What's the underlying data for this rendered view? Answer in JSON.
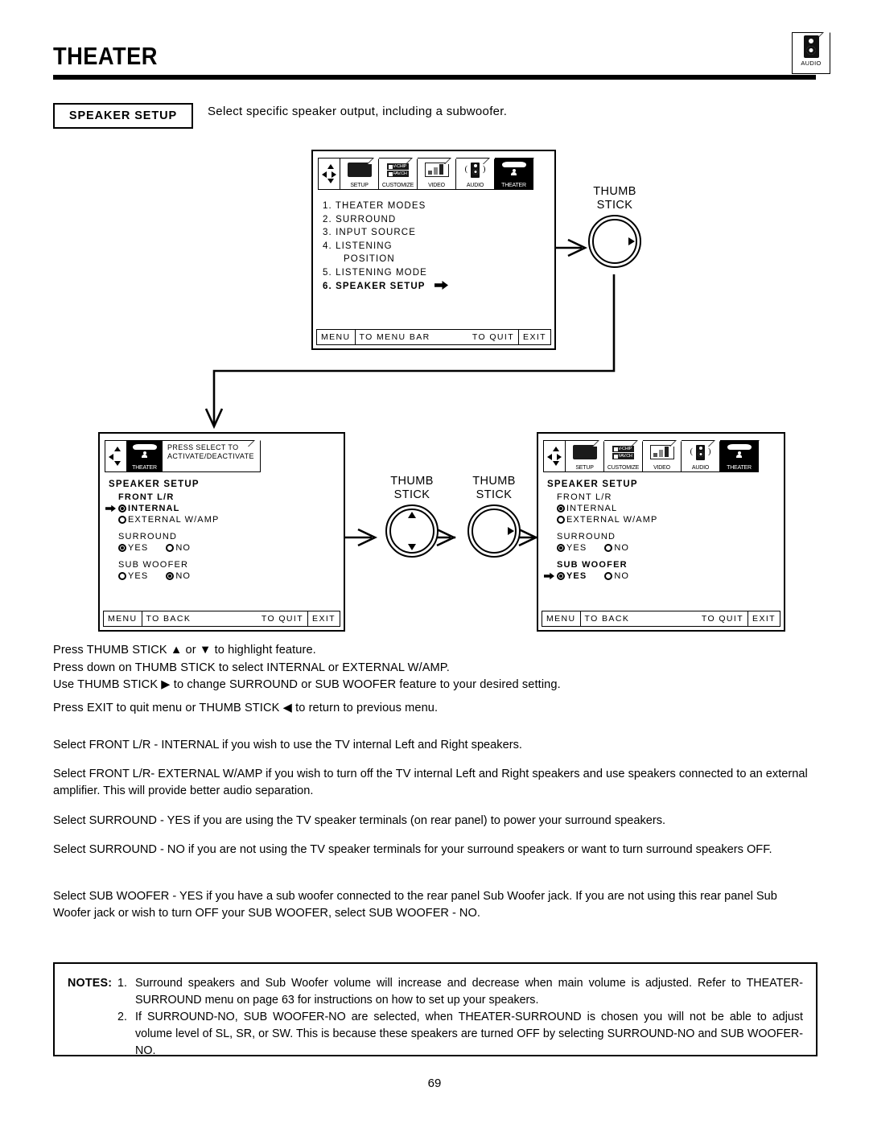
{
  "header": {
    "title": "THEATER",
    "badge": {
      "icon": "audio-speaker-icon",
      "label": "AUDIO"
    }
  },
  "section": {
    "tag": "SPEAKER SETUP",
    "description": "Select specific speaker output, including a subwoofer."
  },
  "osd_top": {
    "menubar": {
      "navpad": "navpad-icon",
      "tabs": [
        {
          "label": "SETUP",
          "icon": "tv-screen-icon",
          "selected": false
        },
        {
          "label": "CUSTOMIZE",
          "icon": "v-chip-icon",
          "selected": false,
          "lines": [
            "V-CHIP",
            "FAV.CH"
          ]
        },
        {
          "label": "VIDEO",
          "icon": "bar-levels-icon",
          "selected": false
        },
        {
          "label": "AUDIO",
          "icon": "speaker-icon",
          "selected": false
        },
        {
          "label": "THEATER",
          "icon": "theater-icon",
          "selected": true
        }
      ]
    },
    "items": [
      {
        "text": "1. THEATER MODES",
        "selected": false,
        "indent": false
      },
      {
        "text": "2. SURROUND",
        "selected": false,
        "indent": false
      },
      {
        "text": "3. INPUT SOURCE",
        "selected": false,
        "indent": false
      },
      {
        "text": "4. LISTENING",
        "selected": false,
        "indent": false
      },
      {
        "text": "POSITION",
        "selected": false,
        "indent": true
      },
      {
        "text": "5. LISTENING MODE",
        "selected": false,
        "indent": false
      },
      {
        "text": "6. SPEAKER SETUP",
        "selected": true,
        "indent": false,
        "arrow": true
      }
    ],
    "footer": {
      "menu": "MENU",
      "mid_left": "TO MENU BAR",
      "mid_right": "TO QUIT",
      "exit": "EXIT"
    }
  },
  "osd_left": {
    "tip": {
      "line1": "PRESS SELECT TO",
      "line2": "ACTIVATE/DEACTIVATE"
    },
    "tab": {
      "label": "THEATER",
      "icon": "theater-icon"
    },
    "title": "SPEAKER SETUP",
    "groups": [
      {
        "label": "FRONT L/R",
        "label_bold": true,
        "layout": "stacked",
        "options": [
          {
            "label": "INTERNAL",
            "selected": true,
            "cursor": true,
            "bold": true
          },
          {
            "label": "EXTERNAL W/AMP",
            "selected": false,
            "cursor": false,
            "bold": false
          }
        ]
      },
      {
        "label": "SURROUND",
        "label_bold": false,
        "layout": "row",
        "options": [
          {
            "label": "YES",
            "selected": true,
            "cursor": false,
            "bold": false
          },
          {
            "label": "NO",
            "selected": false,
            "cursor": false,
            "bold": false
          }
        ]
      },
      {
        "label": "SUB WOOFER",
        "label_bold": false,
        "layout": "row",
        "options": [
          {
            "label": "YES",
            "selected": false,
            "cursor": false,
            "bold": false
          },
          {
            "label": "NO",
            "selected": true,
            "cursor": false,
            "bold": false
          }
        ]
      }
    ],
    "footer": {
      "menu": "MENU",
      "mid_left": "TO BACK",
      "mid_right": "TO QUIT",
      "exit": "EXIT"
    }
  },
  "osd_right": {
    "menubar": {
      "navpad": "navpad-icon",
      "tabs": [
        {
          "label": "SETUP",
          "icon": "tv-screen-icon",
          "selected": false
        },
        {
          "label": "CUSTOMIZE",
          "icon": "v-chip-icon",
          "selected": false,
          "lines": [
            "V-CHIP",
            "FAV.CH"
          ]
        },
        {
          "label": "VIDEO",
          "icon": "bar-levels-icon",
          "selected": false
        },
        {
          "label": "AUDIO",
          "icon": "speaker-icon",
          "selected": false
        },
        {
          "label": "THEATER",
          "icon": "theater-icon",
          "selected": true
        }
      ]
    },
    "title": "SPEAKER SETUP",
    "groups": [
      {
        "label": "FRONT L/R",
        "label_bold": false,
        "layout": "stacked",
        "options": [
          {
            "label": "INTERNAL",
            "selected": true,
            "cursor": false,
            "bold": false
          },
          {
            "label": "EXTERNAL W/AMP",
            "selected": false,
            "cursor": false,
            "bold": false
          }
        ]
      },
      {
        "label": "SURROUND",
        "label_bold": false,
        "layout": "row",
        "options": [
          {
            "label": "YES",
            "selected": true,
            "cursor": false,
            "bold": false
          },
          {
            "label": "NO",
            "selected": false,
            "cursor": false,
            "bold": false
          }
        ]
      },
      {
        "label": "SUB WOOFER",
        "label_bold": true,
        "layout": "row",
        "options": [
          {
            "label": "YES",
            "selected": true,
            "cursor": true,
            "bold": true
          },
          {
            "label": "NO",
            "selected": false,
            "cursor": false,
            "bold": false
          }
        ]
      }
    ],
    "footer": {
      "menu": "MENU",
      "mid_left": "TO BACK",
      "mid_right": "TO QUIT",
      "exit": "EXIT"
    }
  },
  "dials": [
    {
      "id": "dial-top",
      "line1": "THUMB",
      "line2": "STICK",
      "arrows": [
        "right"
      ]
    },
    {
      "id": "dial-mid-a",
      "line1": "THUMB",
      "line2": "STICK",
      "arrows": [
        "up",
        "down"
      ]
    },
    {
      "id": "dial-mid-b",
      "line1": "THUMB",
      "line2": "STICK",
      "arrows": [
        "right"
      ]
    }
  ],
  "instructions": [
    "Press THUMB STICK ▲ or ▼ to highlight feature.",
    "Press down on THUMB STICK to select INTERNAL or EXTERNAL W/AMP.",
    "Use THUMB STICK ▶ to change SURROUND or SUB WOOFER feature to your desired setting.",
    "Press EXIT to quit menu or THUMB STICK ◀ to return to previous menu."
  ],
  "paragraphs": {
    "p1": "Select FRONT L/R - INTERNAL if you wish to use the TV internal Left and Right speakers.",
    "p2": "Select FRONT L/R- EXTERNAL W/AMP if you wish to turn off the TV internal Left and Right speakers and use speakers connected to an external amplifier.  This will provide better audio separation.",
    "p3": "Select SURROUND - YES if you are using the TV speaker terminals (on rear panel) to power your surround speakers.",
    "p4": "Select SURROUND - NO if you are not using the TV speaker terminals for your surround speakers or want to turn surround speakers OFF.",
    "p5": "Select SUB WOOFER - YES if you have a sub woofer connected to the rear panel Sub Woofer jack.  If you are not using this rear panel Sub Woofer jack or wish to turn OFF your SUB WOOFER, select SUB WOOFER - NO."
  },
  "notes": {
    "lead": "NOTES:",
    "items": [
      {
        "num": "1.",
        "text": "Surround speakers and Sub Woofer volume will increase and decrease when main volume is adjusted.  Refer to THEATER-SURROUND menu on page 63 for instructions on how to set up your speakers."
      },
      {
        "num": "2.",
        "text": "If SURROUND-NO, SUB WOOFER-NO are selected, when THEATER-SURROUND is chosen you will not be able to adjust volume level of SL, SR, or SW.  This is because these speakers are turned OFF by selecting SURROUND-NO and SUB WOOFER-NO."
      }
    ]
  },
  "page_number": "69",
  "colors": {
    "ink": "#000000",
    "paper": "#ffffff"
  }
}
